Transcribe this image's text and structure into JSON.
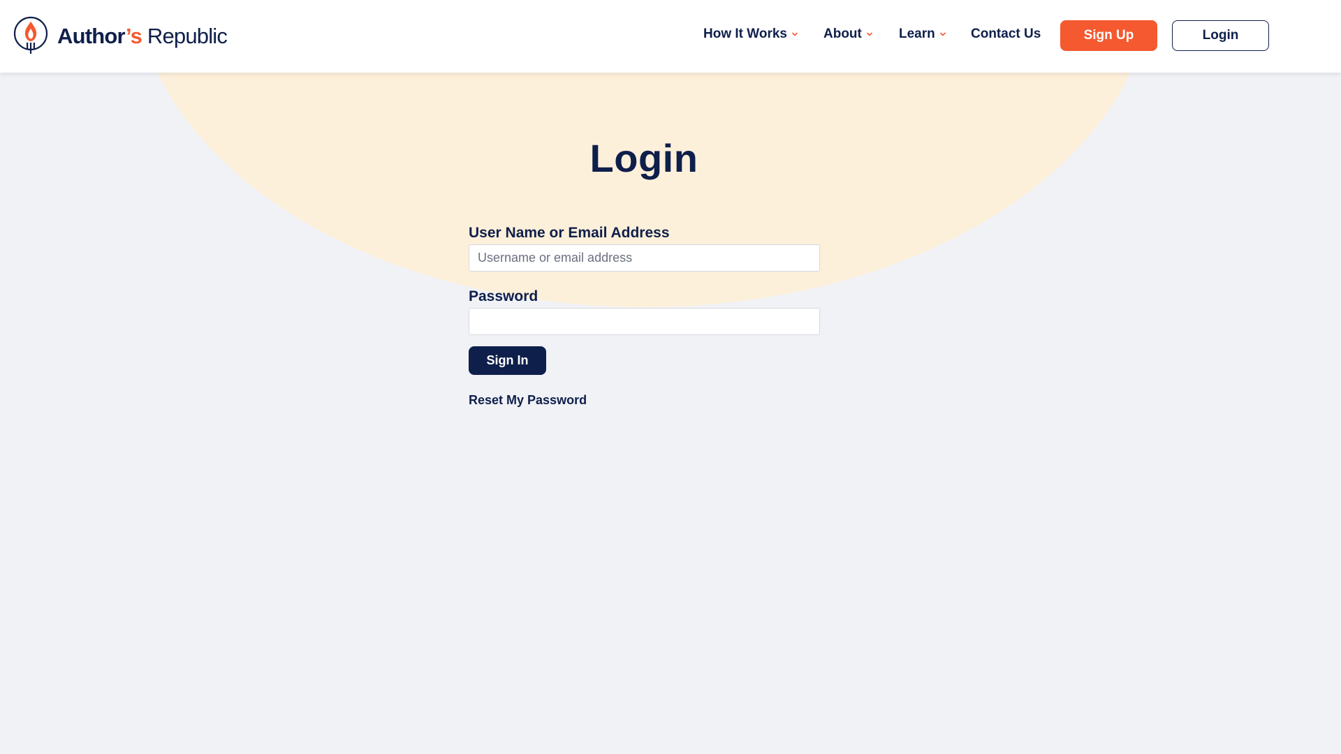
{
  "brand": {
    "name_bold": "Author",
    "name_apostrophe": "’s",
    "name_light": "Republic",
    "accent_color": "#f4592f",
    "navy_color": "#0f1f4b",
    "logo_icon": "flame-quill-icon"
  },
  "nav": {
    "items": [
      {
        "label": "How It Works",
        "has_dropdown": true
      },
      {
        "label": "About",
        "has_dropdown": true
      },
      {
        "label": "Learn",
        "has_dropdown": true
      },
      {
        "label": "Contact Us",
        "has_dropdown": false
      }
    ],
    "signup_label": "Sign Up",
    "login_label": "Login"
  },
  "main": {
    "title": "Login",
    "form": {
      "username_label": "User Name or Email Address",
      "username_placeholder": "Username or email address",
      "username_value": "",
      "password_label": "Password",
      "password_value": "",
      "signin_label": "Sign In",
      "reset_label": "Reset My Password"
    }
  },
  "colors": {
    "page_background": "#f1f2f6",
    "backdrop_circle": "#fdf0da"
  }
}
